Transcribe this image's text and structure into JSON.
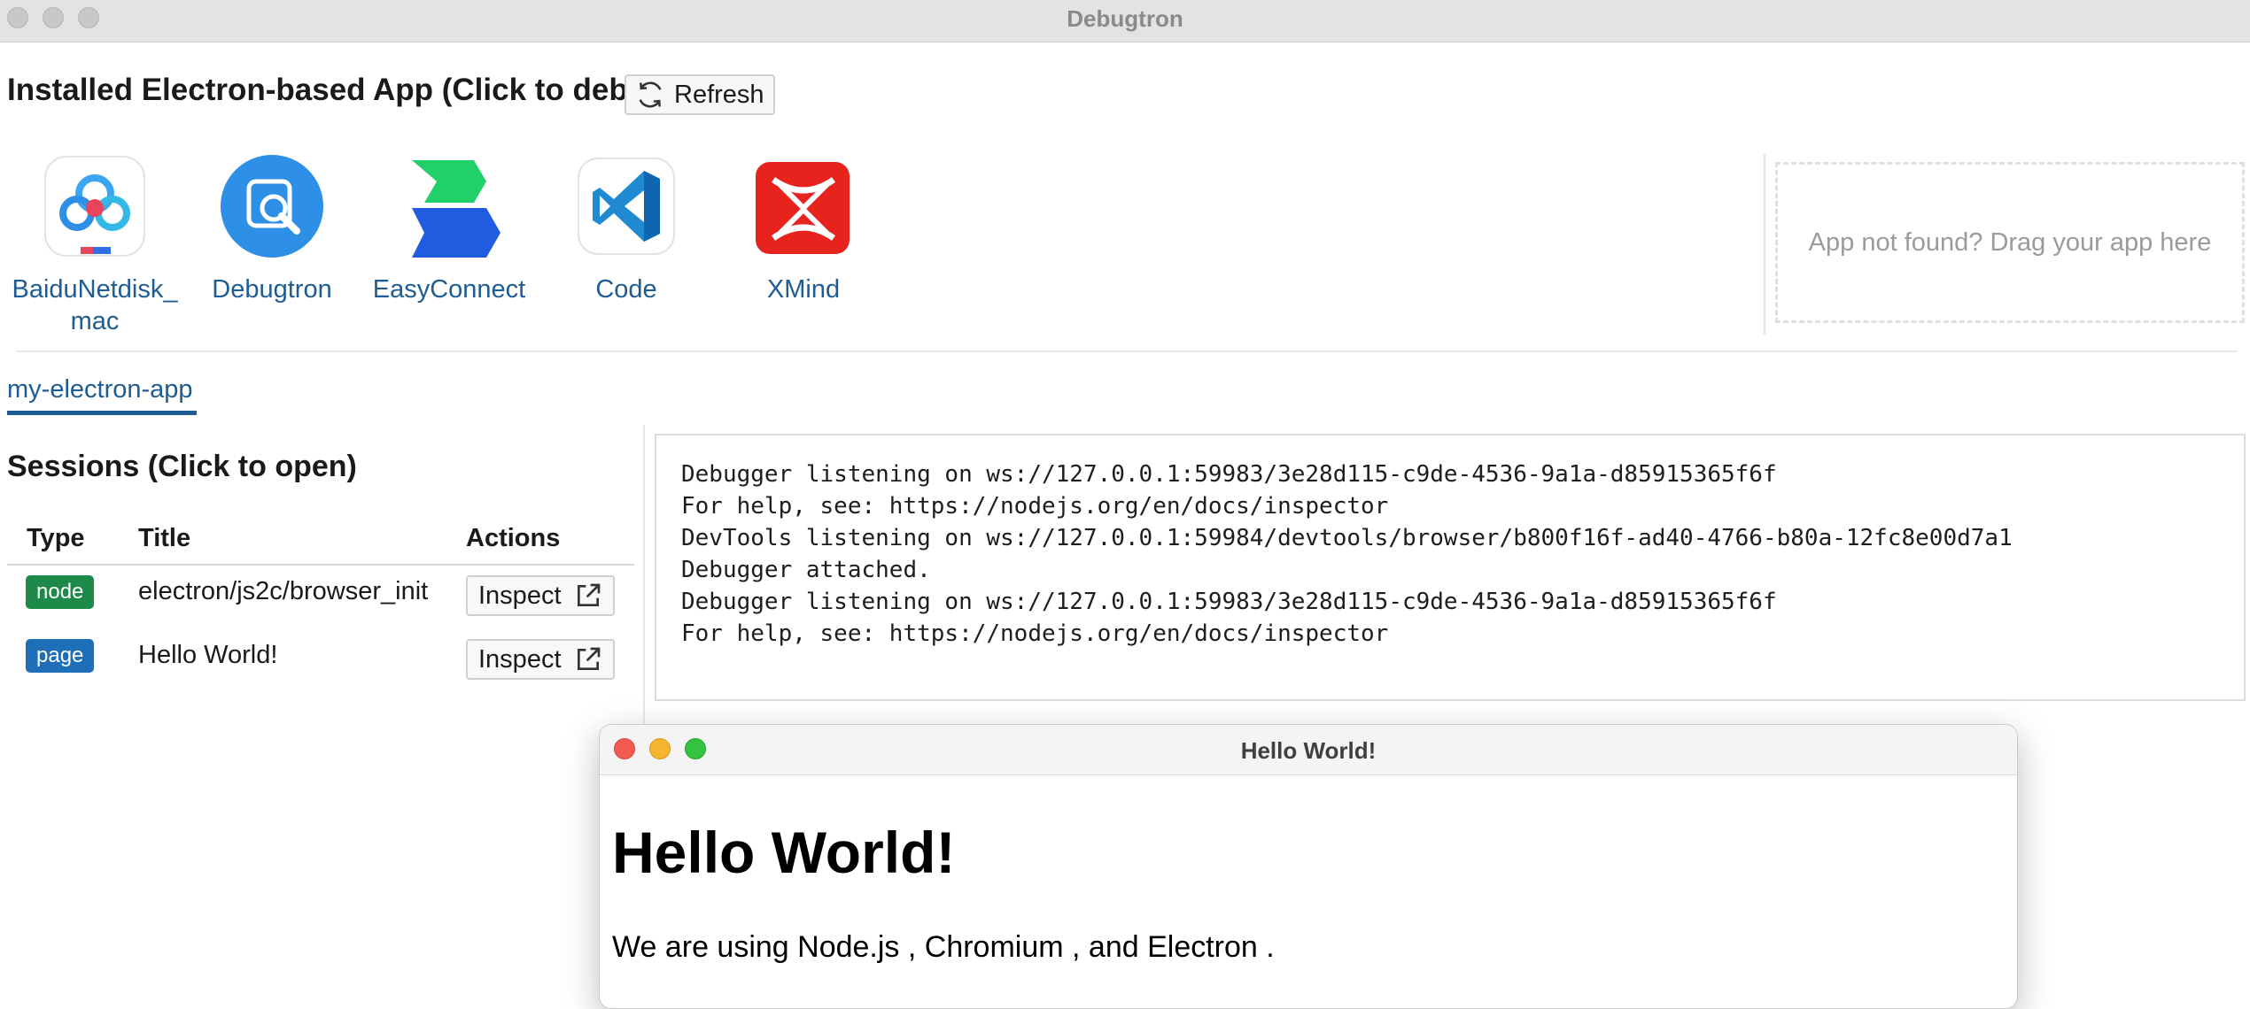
{
  "window": {
    "title": "Debugtron"
  },
  "installed": {
    "title": "Installed Electron-based App (Click to debug)",
    "refresh_label": "Refresh",
    "apps": [
      {
        "name": "BaiduNetdisk_mac",
        "icon": "baidu-netdisk-icon"
      },
      {
        "name": "Debugtron",
        "icon": "debugtron-icon"
      },
      {
        "name": "EasyConnect",
        "icon": "easyconnect-icon"
      },
      {
        "name": "Code",
        "icon": "vscode-icon"
      },
      {
        "name": "XMind",
        "icon": "xmind-icon"
      }
    ],
    "dropzone_text": "App not found? Drag your app here"
  },
  "tabs": [
    {
      "label": "my-electron-app",
      "active": true
    }
  ],
  "sessions": {
    "title": "Sessions (Click to open)",
    "columns": [
      "Type",
      "Title",
      "Actions"
    ],
    "rows": [
      {
        "type": "node",
        "title": "electron/js2c/browser_init",
        "action": "Inspect"
      },
      {
        "type": "page",
        "title": "Hello World!",
        "action": "Inspect"
      }
    ]
  },
  "log": {
    "lines": [
      "Debugger listening on ws://127.0.0.1:59983/3e28d115-c9de-4536-9a1a-d85915365f6f",
      "For help, see: https://nodejs.org/en/docs/inspector",
      "",
      "DevTools listening on ws://127.0.0.1:59984/devtools/browser/b800f16f-ad40-4766-b80a-12fc8e00d7a1",
      "Debugger attached.",
      "Debugger listening on ws://127.0.0.1:59983/3e28d115-c9de-4536-9a1a-d85915365f6f",
      "For help, see: https://nodejs.org/en/docs/inspector"
    ]
  },
  "hello_window": {
    "title": "Hello World!",
    "heading": "Hello World!",
    "text": "We are using Node.js , Chromium , and Electron ."
  },
  "colors": {
    "accent": "#1e5c93",
    "badge_node": "#1e8a4a",
    "badge_page": "#1f6fb8",
    "mac_close": "#f25b52",
    "mac_minimize": "#f5b52e",
    "mac_zoom": "#35c240"
  }
}
